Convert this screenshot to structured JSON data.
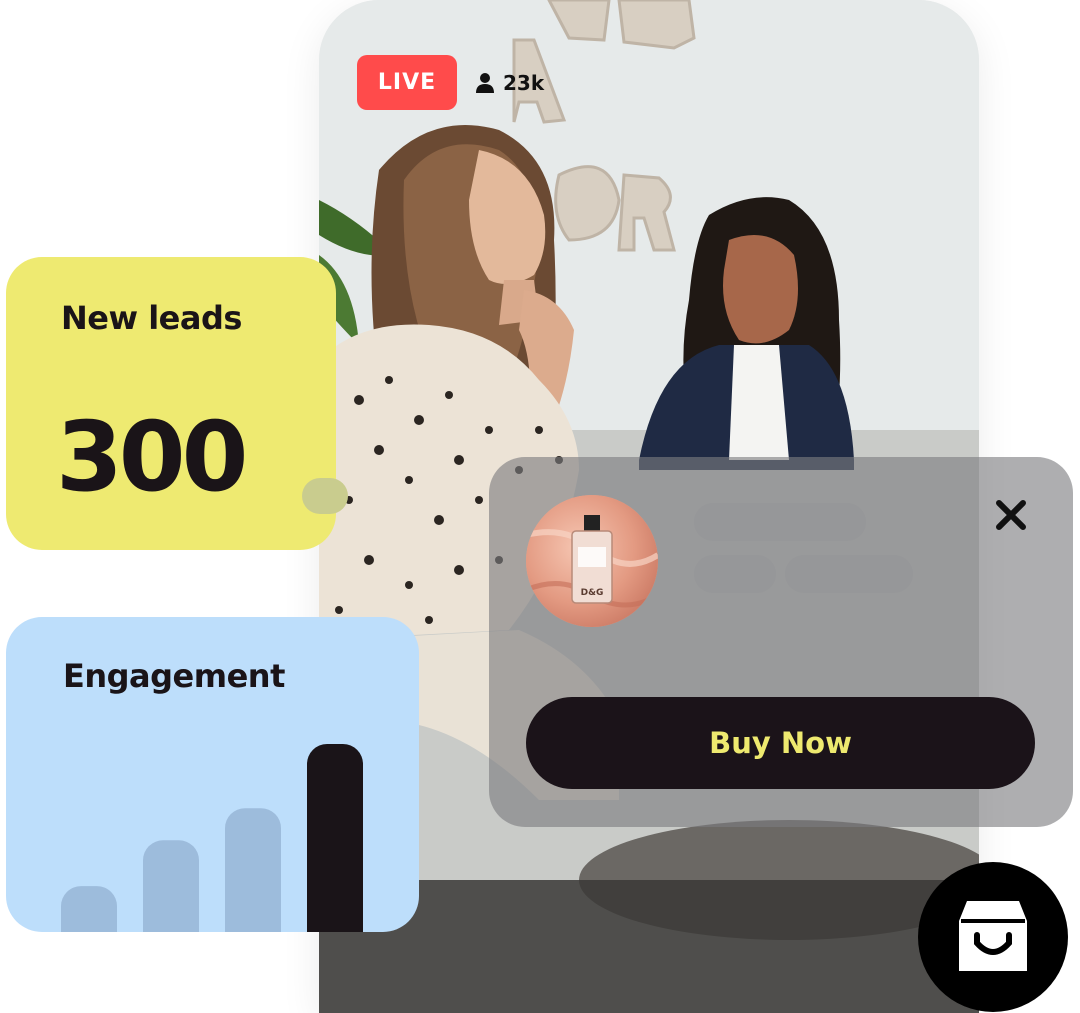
{
  "stream": {
    "live_label": "LIVE",
    "viewer_count": "23k",
    "icons": {
      "viewers": "person-icon"
    }
  },
  "product_popup": {
    "buy_label": "Buy Now",
    "product_brand_mark": "D&G",
    "icons": {
      "close": "close-icon"
    }
  },
  "leads_card": {
    "title": "New leads",
    "value": "300"
  },
  "engagement_card": {
    "title": "Engagement"
  },
  "shop_button": {
    "icon": "shopping-bag-icon"
  },
  "chart_data": {
    "type": "bar",
    "title": "Engagement",
    "categories": [
      "",
      "",
      "",
      ""
    ],
    "values": [
      1,
      2,
      2.7,
      4.1
    ],
    "highlight_index": 3,
    "colors": {
      "bar": "#9dbcdc",
      "highlight": "#1a1418"
    }
  },
  "colors": {
    "live_red": "#ff4b4b",
    "leads_yellow": "#eeea71",
    "engagement_blue": "#bddefb",
    "buy_button_bg": "#1b1319",
    "buy_button_text": "#eee96f"
  }
}
